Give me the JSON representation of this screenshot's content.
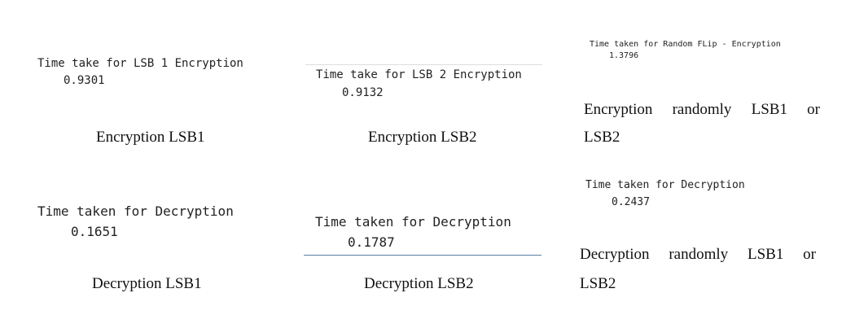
{
  "col1": {
    "enc_label": "Time take for LSB 1 Encryption",
    "enc_value": "0.9301",
    "enc_caption": "Encryption LSB1",
    "dec_label": "Time taken for Decryption",
    "dec_value": "0.1651",
    "dec_caption": "Decryption LSB1"
  },
  "col2": {
    "enc_label": "Time take for LSB 2 Encryption",
    "enc_value": "0.9132",
    "enc_caption": "Encryption LSB2",
    "dec_label": "Time taken for Decryption",
    "dec_value": "0.1787",
    "dec_caption": "Decryption LSB2"
  },
  "col3": {
    "enc_label": "Time taken for Random FLip - Encryption",
    "enc_value": "1.3796",
    "enc_caption_words": [
      "Encryption",
      "randomly",
      "LSB1",
      "or"
    ],
    "enc_caption_line2": "LSB2",
    "dec_label": "Time taken for Decryption",
    "dec_value": "0.2437",
    "dec_caption_words": [
      "Decryption",
      "randomly",
      "LSB1",
      "or"
    ],
    "dec_caption_line2": "LSB2"
  },
  "colors": {
    "separator_light": "#dddddd",
    "separator_blue": "#5b7fa6"
  }
}
